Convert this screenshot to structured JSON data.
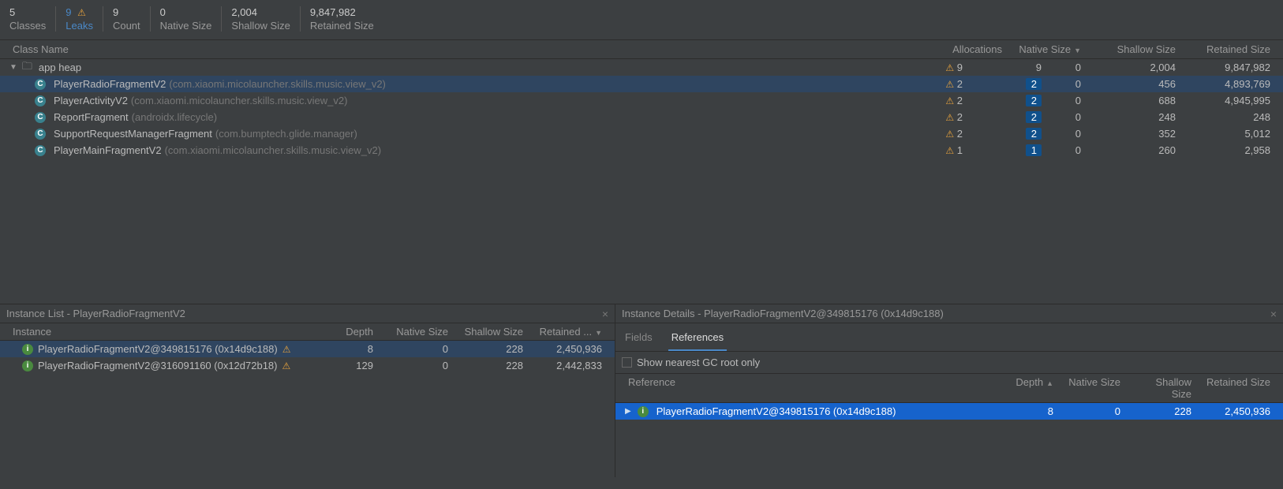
{
  "stats": [
    {
      "value": "5",
      "label": "Classes",
      "warn": false,
      "active": false
    },
    {
      "value": "9",
      "label": "Leaks",
      "warn": true,
      "active": true
    },
    {
      "value": "9",
      "label": "Count",
      "warn": false,
      "active": false
    },
    {
      "value": "0",
      "label": "Native Size",
      "warn": false,
      "active": false
    },
    {
      "value": "2,004",
      "label": "Shallow Size",
      "warn": false,
      "active": false
    },
    {
      "value": "9,847,982",
      "label": "Retained Size",
      "warn": false,
      "active": false
    }
  ],
  "class_table": {
    "headers": {
      "name": "Class Name",
      "allocations": "Allocations",
      "native": "Native Size",
      "shallow": "Shallow Size",
      "retained": "Retained Size",
      "sort_col": "native",
      "sort_dir": "desc"
    },
    "root": {
      "expanded": true,
      "label": "app heap",
      "warn": true,
      "allocations": "9",
      "alloc_pill": "9",
      "native": "0",
      "shallow": "2,004",
      "retained": "9,847,982"
    },
    "rows": [
      {
        "name": "PlayerRadioFragmentV2",
        "pkg": "(com.xiaomi.micolauncher.skills.music.view_v2)",
        "warn": true,
        "allocations": "2",
        "alloc_pill": "2",
        "native": "0",
        "shallow": "456",
        "retained": "4,893,769",
        "selected": true
      },
      {
        "name": "PlayerActivityV2",
        "pkg": "(com.xiaomi.micolauncher.skills.music.view_v2)",
        "warn": true,
        "allocations": "2",
        "alloc_pill": "2",
        "native": "0",
        "shallow": "688",
        "retained": "4,945,995",
        "selected": false
      },
      {
        "name": "ReportFragment",
        "pkg": "(androidx.lifecycle)",
        "warn": true,
        "allocations": "2",
        "alloc_pill": "2",
        "native": "0",
        "shallow": "248",
        "retained": "248",
        "selected": false
      },
      {
        "name": "SupportRequestManagerFragment",
        "pkg": "(com.bumptech.glide.manager)",
        "warn": true,
        "allocations": "2",
        "alloc_pill": "2",
        "native": "0",
        "shallow": "352",
        "retained": "5,012",
        "selected": false
      },
      {
        "name": "PlayerMainFragmentV2",
        "pkg": "(com.xiaomi.micolauncher.skills.music.view_v2)",
        "warn": true,
        "allocations": "1",
        "alloc_pill": "1",
        "native": "0",
        "shallow": "260",
        "retained": "2,958",
        "selected": false
      }
    ]
  },
  "instance_list": {
    "title": "Instance List - PlayerRadioFragmentV2",
    "headers": {
      "instance": "Instance",
      "depth": "Depth",
      "native": "Native Size",
      "shallow": "Shallow Size",
      "retained": "Retained ...",
      "sort_col": "retained",
      "sort_dir": "desc"
    },
    "rows": [
      {
        "name": "PlayerRadioFragmentV2@349815176 (0x14d9c188)",
        "warn": true,
        "depth": "8",
        "native": "0",
        "shallow": "228",
        "retained": "2,450,936",
        "selected": true
      },
      {
        "name": "PlayerRadioFragmentV2@316091160 (0x12d72b18)",
        "warn": true,
        "depth": "129",
        "native": "0",
        "shallow": "228",
        "retained": "2,442,833",
        "selected": false
      }
    ]
  },
  "instance_details": {
    "title": "Instance Details - PlayerRadioFragmentV2@349815176 (0x14d9c188)",
    "tabs": [
      {
        "label": "Fields",
        "active": false
      },
      {
        "label": "References",
        "active": true
      }
    ],
    "gc_checkbox_label": "Show nearest GC root only",
    "gc_checked": false,
    "ref_headers": {
      "reference": "Reference",
      "depth": "Depth",
      "native": "Native Size",
      "shallow": "Shallow Size",
      "retained": "Retained Size",
      "sort_col": "depth",
      "sort_dir": "asc"
    },
    "ref_rows": [
      {
        "name": "PlayerRadioFragmentV2@349815176 (0x14d9c188)",
        "depth": "8",
        "native": "0",
        "shallow": "228",
        "retained": "2,450,936",
        "selected": true,
        "expandable": true
      }
    ]
  }
}
